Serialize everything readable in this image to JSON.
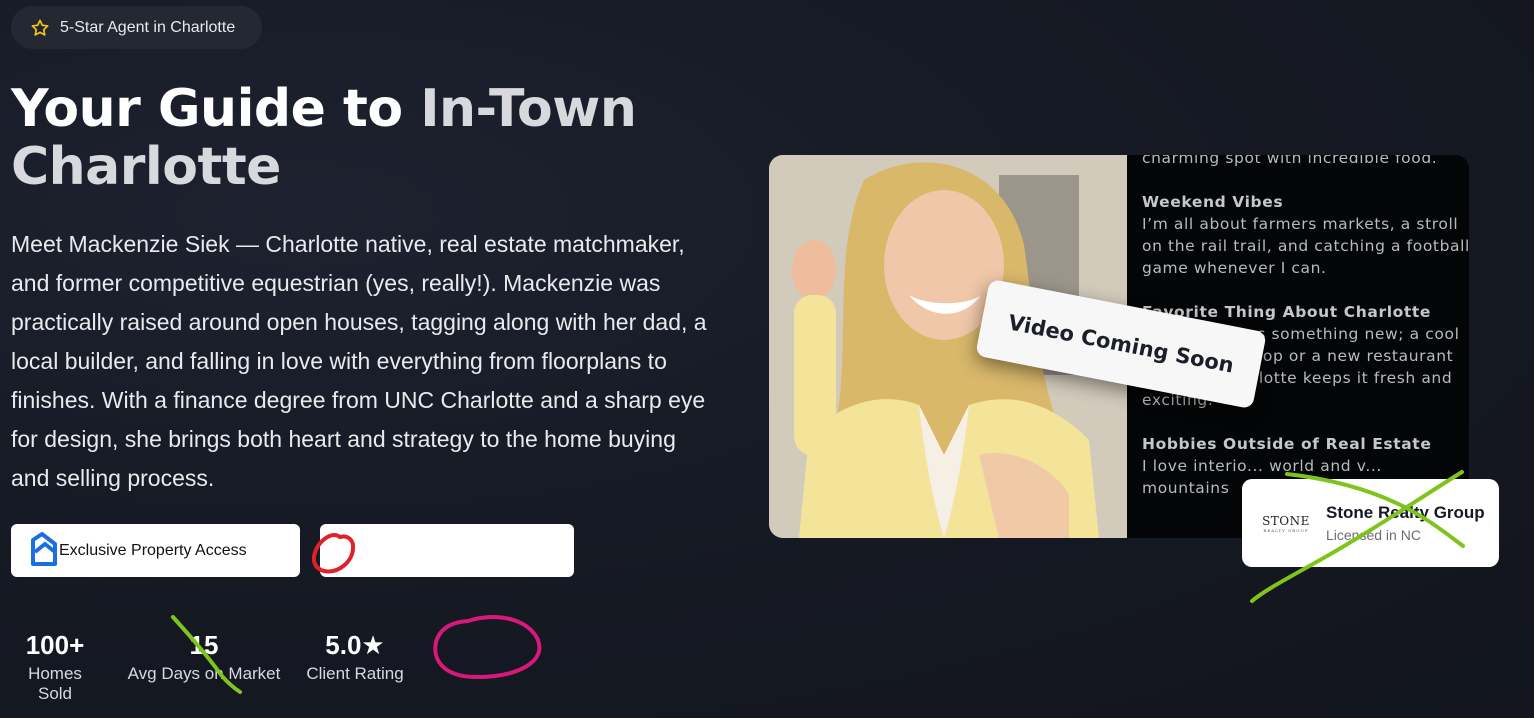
{
  "badge": {
    "icon": "star-outline-icon",
    "label": "5-Star Agent in Charlotte",
    "icon_color": "#f5c518"
  },
  "headline": {
    "part1": "Your Guide to ",
    "accent": "In-Town",
    "part2": "Charlotte"
  },
  "bio": "Meet Mackenzie Siek — Charlotte native, real estate matchmaker, and former competitive equestrian (yes, really!). Mackenzie was practically raised around open houses, tagging along with her dad, a local builder, and falling in love with everything from floorplans to finishes. With a finance degree from UNC Charlotte and a sharp eye for design, she brings both heart and strategy to the home buying and selling process.",
  "features": [
    {
      "icon": "house-icon",
      "label": "Exclusive Property Access",
      "icon_color": "#1a6fe0"
    },
    {
      "icon": "house-icon",
      "label": "",
      "icon_color": "#e0202a"
    }
  ],
  "stats": [
    {
      "value": "100+",
      "label": "Homes Sold"
    },
    {
      "value": "15",
      "label": "Avg Days on Market"
    },
    {
      "value": "5.0★",
      "label": "Client Rating"
    }
  ],
  "about": {
    "intro_tail": "charming spot with incredible food.",
    "sections": [
      {
        "heading": "Weekend Vibes",
        "text": "I’m all about farmers markets, a stroll on the rail trail, and catching a football game whenever I can."
      },
      {
        "heading": "Favorite Thing About Charlotte",
        "text": "There’s always something new; a cool local coffee shop or a new restaurant opening, Charlotte keeps it fresh and exciting."
      },
      {
        "heading": "Hobbies Outside of Real Estate",
        "text": "I love interio... world and v... mountains"
      }
    ]
  },
  "video": {
    "label": "Video Coming Soon"
  },
  "brokerage": {
    "logo_text": "STONE",
    "logo_sub": "REALTY GROUP",
    "name": "Stone Realty Group",
    "license": "Licensed in NC"
  },
  "annotations": {
    "green": "#7fc41c",
    "magenta": "#d9197a",
    "red": "#e0202a"
  }
}
